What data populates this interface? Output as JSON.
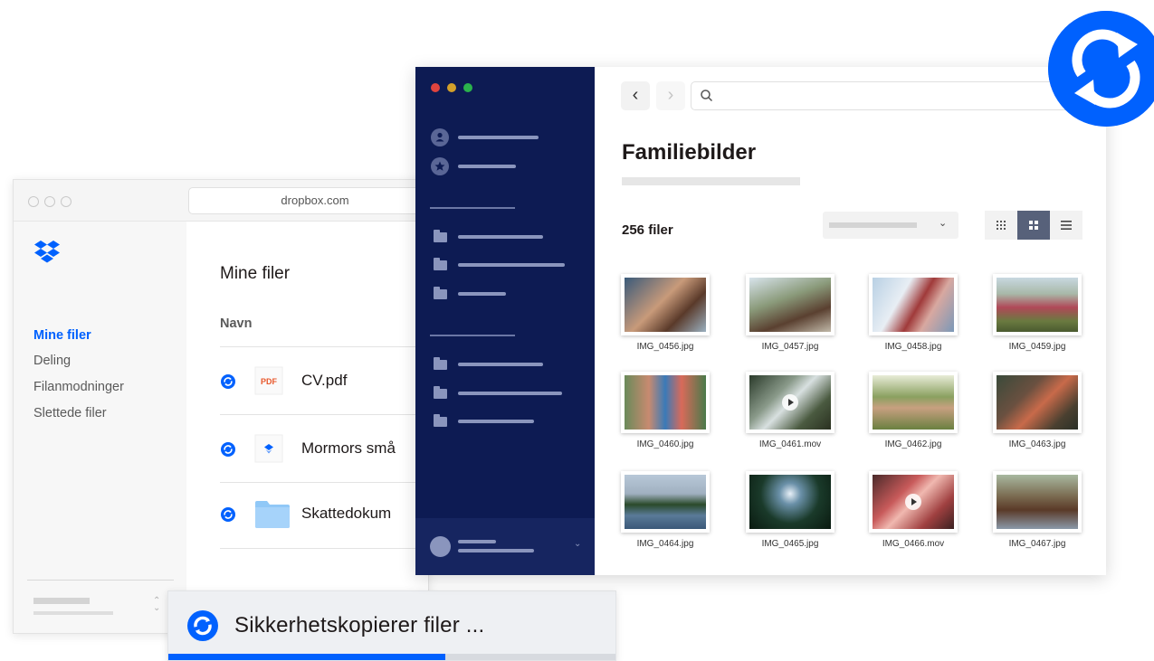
{
  "browser": {
    "url": "dropbox.com",
    "sidebar": {
      "items": [
        {
          "label": "Mine filer",
          "active": true
        },
        {
          "label": "Deling",
          "active": false
        },
        {
          "label": "Filanmodninger",
          "active": false
        },
        {
          "label": "Slettede filer",
          "active": false
        }
      ]
    },
    "main": {
      "title": "Mine filer",
      "column_header": "Navn",
      "files": [
        {
          "name": "CV.pdf",
          "icon": "pdf-icon",
          "icon_label": "PDF"
        },
        {
          "name": "Mormors små",
          "icon": "dropbox-paper-icon"
        },
        {
          "name": "Skattedokum",
          "icon": "folder-icon"
        }
      ]
    }
  },
  "toast": {
    "text": "Sikkerhetskopierer filer ...",
    "progress_percent": 62
  },
  "app": {
    "title": "Familiebilder",
    "file_count": "256 filer",
    "files": [
      {
        "name": "IMG_0456.jpg",
        "type": "image"
      },
      {
        "name": "IMG_0457.jpg",
        "type": "image"
      },
      {
        "name": "IMG_0458.jpg",
        "type": "image"
      },
      {
        "name": "IMG_0459.jpg",
        "type": "image"
      },
      {
        "name": "IMG_0460.jpg",
        "type": "image"
      },
      {
        "name": "IMG_0461.mov",
        "type": "video"
      },
      {
        "name": "IMG_0462.jpg",
        "type": "image"
      },
      {
        "name": "IMG_0463.jpg",
        "type": "image"
      },
      {
        "name": "IMG_0464.jpg",
        "type": "image"
      },
      {
        "name": "IMG_0465.jpg",
        "type": "image"
      },
      {
        "name": "IMG_0466.mov",
        "type": "video"
      },
      {
        "name": "IMG_0467.jpg",
        "type": "image"
      }
    ]
  },
  "colors": {
    "accent": "#0061fe",
    "nav_background": "#0d1b53",
    "window_red": "#e0443e",
    "window_yellow": "#d3a02a",
    "window_green": "#2bb24c"
  }
}
